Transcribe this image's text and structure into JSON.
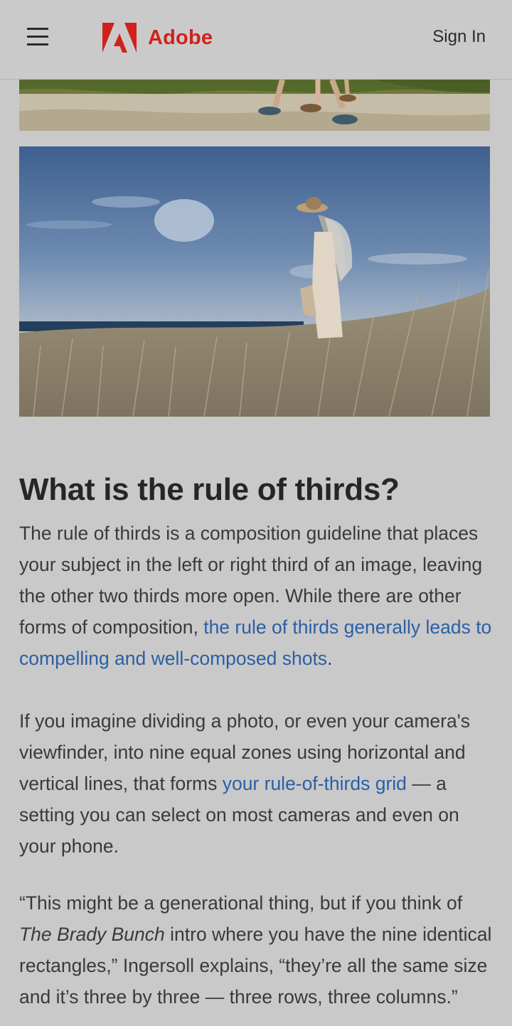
{
  "header": {
    "menu_icon": "hamburger-menu-icon",
    "brand_name": "Adobe",
    "brand_color": "#d0221c",
    "sign_in_label": "Sign In"
  },
  "article": {
    "heading": "What is the rule of thirds?",
    "p1": {
      "text_a": "The rule of thirds is a composition guideline that places your subject in the left or right third of an image, leaving the other two thirds more open. While there are other forms of composition, ",
      "link": "the rule of thirds generally leads to compelling and well-composed shots",
      "text_b": "."
    },
    "p2": {
      "text_a": "If you imagine dividing a photo, or even your camera's viewfinder, into nine equal zones using horizontal and vertical lines, that forms ",
      "link": "your rule-of-thirds grid",
      "text_b": " — a setting you can select on most cameras and even on your phone."
    },
    "p3": {
      "text_a": "“This might be a generational thing, but if you think of ",
      "italic": "The Brady Bunch",
      "text_b": " intro where you have the nine identical rectangles,” Ingersoll explains, “they’re all the same size and it’s three by three — three rows, three columns.”"
    }
  },
  "colors": {
    "link": "#2b5fa5",
    "background": "#c9c9c9"
  }
}
